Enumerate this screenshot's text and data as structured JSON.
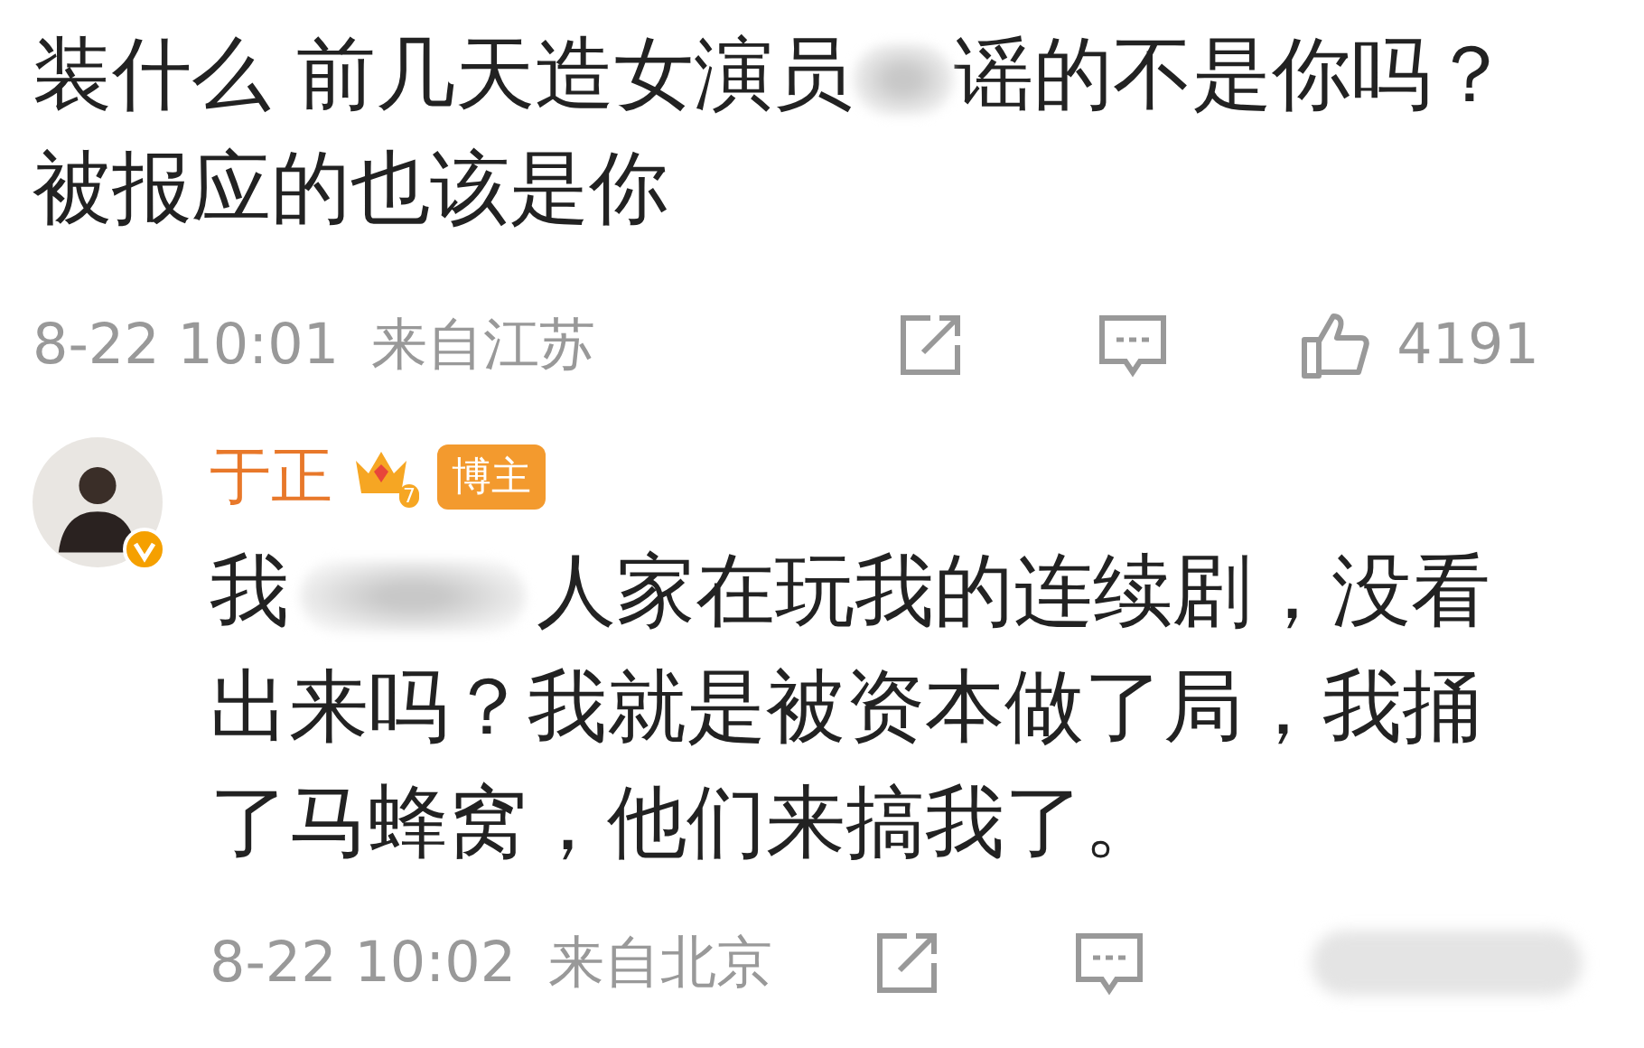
{
  "comment": {
    "segments": [
      {
        "kind": "text",
        "text": "装什么 前几天造女演员"
      },
      {
        "kind": "blur"
      },
      {
        "kind": "text",
        "text": "谣的不是你吗？被报应的也该是你"
      }
    ],
    "date": "8-22 10:01",
    "location": "来自江苏",
    "likes": "4191"
  },
  "reply": {
    "author": {
      "name": "于正",
      "verified": true,
      "crown_level": "7",
      "badge": "博主"
    },
    "segments": [
      {
        "kind": "text",
        "text": "我"
      },
      {
        "kind": "blur"
      },
      {
        "kind": "text",
        "text": "人家在玩我的连续剧，没看出来吗？我就是被资本做了局，我捅了马蜂窝，他们来搞我了。"
      }
    ],
    "date": "8-22 10:02",
    "location": "来自北京",
    "likes_obscured": true
  }
}
